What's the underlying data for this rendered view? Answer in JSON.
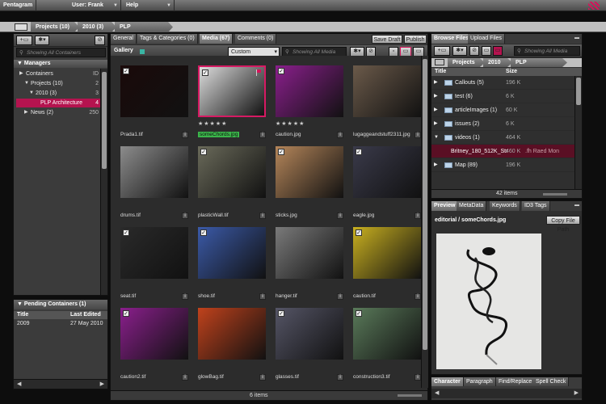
{
  "menubar": {
    "items": [
      "Pentagram",
      "User: Frank",
      "Help"
    ]
  },
  "breadcrumb": [
    "Projects (10)",
    "2010 (3)",
    "PLP Architecture"
  ],
  "left": {
    "search_placeholder": "Showing All Containers",
    "managers_label": "Managers",
    "tree": [
      {
        "label": "Containers",
        "count": "ID",
        "indent": 0,
        "tri": "▶"
      },
      {
        "label": "Projects (10)",
        "count": "2",
        "indent": 1,
        "tri": "▼"
      },
      {
        "label": "2010 (3)",
        "count": "3",
        "indent": 2,
        "tri": "▼"
      },
      {
        "label": "PLP Architecture",
        "count": "4",
        "indent": 3,
        "tri": "",
        "selected": true
      },
      {
        "label": "News (2)",
        "count": "250",
        "indent": 1,
        "tri": "▶"
      }
    ],
    "pending_title": "Pending Containers (1)",
    "pending_cols": [
      "Title",
      "Last Edited"
    ],
    "pending_rows": [
      {
        "title": "2009",
        "date": "27 May 2010"
      }
    ]
  },
  "center": {
    "tabs": [
      "General",
      "Tags & Categories (0)",
      "Media (67)",
      "Comments (0)"
    ],
    "active_tab": 2,
    "save_draft": "Save Draft",
    "publish": "Publish",
    "gallery_label": "Gallery",
    "dropdown": "Custom",
    "search_placeholder": "Showing All Media",
    "items": [
      {
        "name": "Prada1.tif",
        "checked": true,
        "flag": false,
        "selected": false,
        "color": "#1a0a0a"
      },
      {
        "name": "someChords.jpg",
        "checked": true,
        "flag": true,
        "selected": true,
        "color": "#dcdcdc",
        "rating": "★★★★★"
      },
      {
        "name": "caution.jpg",
        "checked": true,
        "flag": false,
        "selected": false,
        "color": "#8a1f8c",
        "rating": "★★★★★"
      },
      {
        "name": "lugaggeandstuff2311.jpg",
        "checked": false,
        "flag": false,
        "selected": false,
        "color": "#6b5a4a"
      },
      {
        "name": "drums.tif",
        "checked": false,
        "flag": false,
        "selected": false,
        "color": "#8c8c8c"
      },
      {
        "name": "plasticWall.tif",
        "checked": true,
        "flag": false,
        "selected": false,
        "color": "#6a6a5a"
      },
      {
        "name": "sticks.jpg",
        "checked": true,
        "flag": false,
        "selected": false,
        "color": "#b5865a"
      },
      {
        "name": "eagle.jpg",
        "checked": true,
        "flag": false,
        "selected": false,
        "color": "#3a3a4a"
      },
      {
        "name": "seat.tif",
        "checked": true,
        "flag": false,
        "selected": false,
        "color": "#2a2a2a"
      },
      {
        "name": "shoe.tif",
        "checked": true,
        "flag": false,
        "selected": false,
        "color": "#3b5aa8"
      },
      {
        "name": "hanger.tif",
        "checked": false,
        "flag": false,
        "selected": false,
        "color": "#7a7a7a"
      },
      {
        "name": "caution.tif",
        "checked": true,
        "flag": false,
        "selected": false,
        "color": "#c9b020"
      },
      {
        "name": "caution2.tif",
        "checked": true,
        "flag": false,
        "selected": false,
        "color": "#8a1f8c"
      },
      {
        "name": "glowBag.tif",
        "checked": false,
        "flag": false,
        "selected": false,
        "color": "#c0421c"
      },
      {
        "name": "glasses.tif",
        "checked": true,
        "flag": false,
        "selected": false,
        "color": "#555566"
      },
      {
        "name": "construction3.tif",
        "checked": true,
        "flag": false,
        "selected": false,
        "color": "#5a7a5a"
      }
    ],
    "footer": "6 items"
  },
  "right": {
    "tabs": [
      "Browse Files",
      "Upload Files"
    ],
    "search_placeholder": "Showing All Media",
    "crumbs": [
      "Projects (10)",
      "2010 (3)",
      "PLP Architecture"
    ],
    "cols": [
      "Title",
      "Size"
    ],
    "rows": [
      {
        "name": "Callouts (5)",
        "size": "196 K",
        "folder": true,
        "tri": "▶"
      },
      {
        "name": "test (6)",
        "size": "6 K",
        "folder": true,
        "tri": "▶"
      },
      {
        "name": "articleImages (1)",
        "size": "60 K",
        "folder": true,
        "tri": "▶"
      },
      {
        "name": "issues (2)",
        "size": "6 K",
        "folder": true,
        "tri": "▶"
      },
      {
        "name": "videos (1)",
        "size": "464 K",
        "folder": true,
        "tri": "▼"
      },
      {
        "name": "Britney_180_512K_Str",
        "size": "460 K",
        "extra": ".fh  Raed   Mon",
        "folder": false,
        "tri": "",
        "selected": true
      },
      {
        "name": "Map (89)",
        "size": "196 K",
        "folder": true,
        "tri": "▶"
      }
    ],
    "footer": "42 items",
    "preview_tabs": [
      "Preview",
      "MetaData",
      "Keywords",
      "ID3 Tags"
    ],
    "preview_path": "editorial / someChords.jpg",
    "copy_path": "Copy File Path",
    "bottom_tabs": [
      "Character",
      "Paragraph",
      "Find/Replace",
      "Spell Check"
    ]
  }
}
